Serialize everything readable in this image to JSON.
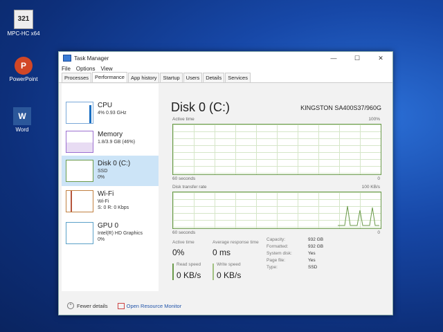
{
  "desktop": {
    "icons": [
      {
        "label": "MPC-HC x64",
        "glyph": "321"
      },
      {
        "label": "PowerPoint",
        "glyph": "P"
      },
      {
        "label": "Word",
        "glyph": "W"
      }
    ]
  },
  "window": {
    "title": "Task Manager",
    "controls": {
      "minimize": "—",
      "maximize": "☐",
      "close": "✕"
    },
    "menu": [
      "File",
      "Options",
      "View"
    ],
    "tabs": [
      "Processes",
      "Performance",
      "App history",
      "Startup",
      "Users",
      "Details",
      "Services"
    ],
    "active_tab": "Performance"
  },
  "sidebar": {
    "items": [
      {
        "name": "CPU",
        "sub1": "4% 0.93 GHz",
        "sub2": ""
      },
      {
        "name": "Memory",
        "sub1": "1.8/3.9 GB (46%)",
        "sub2": "",
        "fill_fraction": 0.46
      },
      {
        "name": "Disk 0 (C:)",
        "sub1": "SSD",
        "sub2": "0%"
      },
      {
        "name": "Wi-Fi",
        "sub1": "Wi-Fi",
        "sub2": "S: 0 R: 0 Kbps"
      },
      {
        "name": "GPU 0",
        "sub1": "Intel(R) HD Graphics",
        "sub2": "0%"
      }
    ],
    "selected_index": 2
  },
  "detail": {
    "title": "Disk 0 (C:)",
    "model": "KINGSTON SA400S37/960G",
    "graph1": {
      "label": "Active time",
      "max": "100%",
      "time": "60 seconds",
      "min": "0"
    },
    "graph2": {
      "label": "Disk transfer rate",
      "max": "100 KB/s",
      "time": "60 seconds",
      "min": "0"
    },
    "stats": {
      "active_time_label": "Active time",
      "active_time_value": "0%",
      "response_label": "Average response time",
      "response_value": "0 ms",
      "read_label": "Read speed",
      "read_value": "0 KB/s",
      "write_label": "Write speed",
      "write_value": "0 KB/s"
    },
    "properties": [
      {
        "k": "Capacity:",
        "v": "932 GB"
      },
      {
        "k": "Formatted:",
        "v": "932 GB"
      },
      {
        "k": "System disk:",
        "v": "Yes"
      },
      {
        "k": "Page file:",
        "v": "Yes"
      },
      {
        "k": "Type:",
        "v": "SSD"
      }
    ]
  },
  "footer": {
    "fewer_details": "Fewer details",
    "open_monitor": "Open Resource Monitor"
  }
}
